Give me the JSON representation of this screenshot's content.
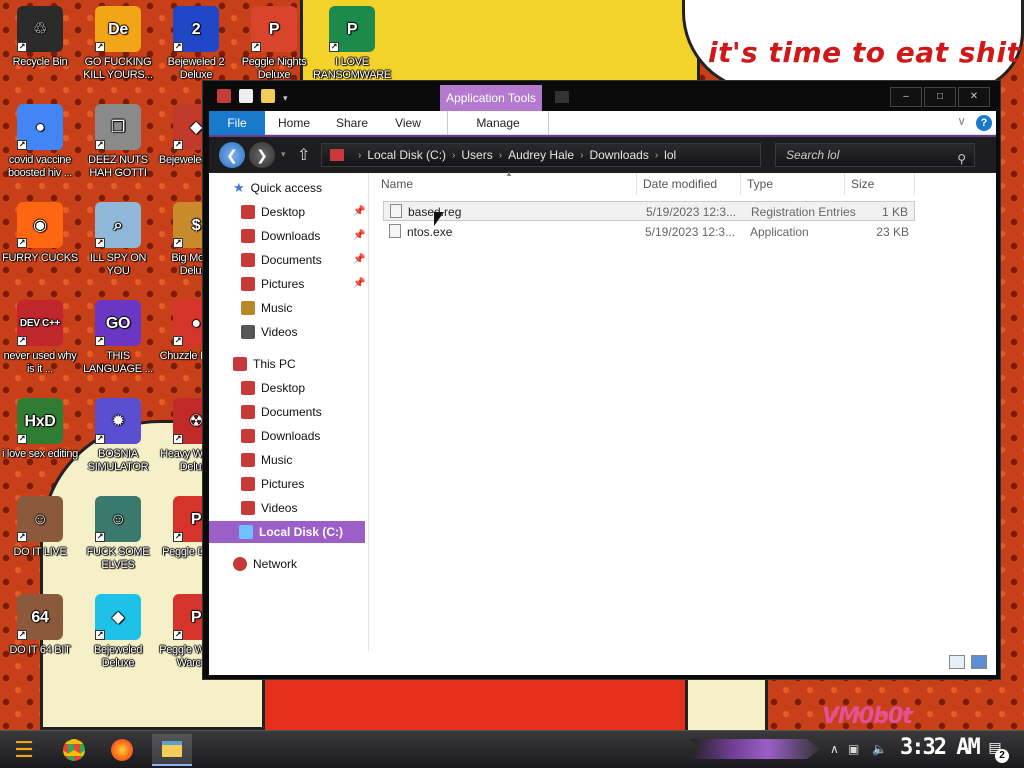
{
  "wallpaper": {
    "bubble_text": "it's time to eat shit",
    "signature": "VM0b0t"
  },
  "desktop_icons": [
    {
      "label": "Recycle Bin",
      "icon": "recycle-bin-icon",
      "color": "#2b2b2b",
      "glyph": "♲"
    },
    {
      "label": "GO FUCKING KILL YOURS...",
      "icon": "de-app-icon",
      "color": "#f2a516",
      "glyph": "De"
    },
    {
      "label": "Bejeweled 2 Deluxe",
      "icon": "bejeweled-2-icon",
      "color": "#2047c8",
      "glyph": "2"
    },
    {
      "label": "Peggle Nights Deluxe",
      "icon": "peggle-nights-icon",
      "color": "#d9452b",
      "glyph": "P"
    },
    {
      "label": "I LOVE RANSOMWARE",
      "icon": "project-icon",
      "color": "#1c8a4b",
      "glyph": "P"
    },
    {
      "label": "covid vaccine boosted hiv ...",
      "icon": "chrome-icon",
      "color": "#4285f4",
      "glyph": "●"
    },
    {
      "label": "DEEZ NUTS HAH GOTTI",
      "icon": "copy-icon",
      "color": "#8a8a8a",
      "glyph": "❐"
    },
    {
      "label": "Bejeweled Twist",
      "icon": "bejeweled-twist-icon",
      "color": "#c0392b",
      "glyph": "◆"
    },
    {
      "label": "FURRY CUCKS",
      "icon": "firefox-icon",
      "color": "#ff6611",
      "glyph": "◉"
    },
    {
      "label": "ILL SPY ON YOU",
      "icon": "spy-icon",
      "color": "#8fb7d8",
      "glyph": "⌕"
    },
    {
      "label": "Big Money Deluxe",
      "icon": "big-money-icon",
      "color": "#c98a2b",
      "glyph": "$"
    },
    {
      "label": "never used why is it ...",
      "icon": "devcpp-icon",
      "color": "#c0262c",
      "glyph": "DEV C++"
    },
    {
      "label": "THIS LANGUAGE ...",
      "icon": "goland-icon",
      "color": "#6a36c4",
      "glyph": "GO"
    },
    {
      "label": "Chuzzle Deluxe",
      "icon": "chuzzle-icon",
      "color": "#d6342a",
      "glyph": "●"
    },
    {
      "label": "i love sex editing",
      "icon": "hxd-icon",
      "color": "#2f7d32",
      "glyph": "HxD"
    },
    {
      "label": "BOSNIA SIMULATOR",
      "icon": "mine-icon",
      "color": "#5a4fd0",
      "glyph": "✹"
    },
    {
      "label": "Heavy Weapon Deluxe",
      "icon": "heavy-weapon-icon",
      "color": "#c22a2a",
      "glyph": "☢"
    },
    {
      "label": "DO IT LIVE",
      "icon": "portrait-icon",
      "color": "#8b5a3c",
      "glyph": "☺"
    },
    {
      "label": "FUCK SOME ELVES",
      "icon": "elf-icon",
      "color": "#3a7a6e",
      "glyph": "☺"
    },
    {
      "label": "Peggle Deluxe",
      "icon": "peggle-icon",
      "color": "#d6342a",
      "glyph": "P"
    },
    {
      "label": "DO IT 64 BIT",
      "icon": "portrait-64-icon",
      "color": "#8b5a3c",
      "glyph": "64"
    },
    {
      "label": "Bejeweled Deluxe",
      "icon": "bejeweled-icon",
      "color": "#1ec2e8",
      "glyph": "◆"
    },
    {
      "label": "Peggle World of Warcraft",
      "icon": "peggle-wow-icon",
      "color": "#d6342a",
      "glyph": "P"
    }
  ],
  "window": {
    "app_tools_label": "Application Tools",
    "ribbon_tabs": [
      "File",
      "Home",
      "Share",
      "View",
      "Manage"
    ],
    "help_glyph": "?",
    "address": {
      "segments": [
        "Local Disk (C:)",
        "Users",
        "Audrey Hale",
        "Downloads",
        "lol"
      ]
    },
    "search_placeholder": "Search lol",
    "nav": {
      "quick_access": "Quick access",
      "quick_items": [
        "Desktop",
        "Downloads",
        "Documents",
        "Pictures",
        "Music",
        "Videos"
      ],
      "this_pc": "This PC",
      "pc_items": [
        "Desktop",
        "Documents",
        "Downloads",
        "Music",
        "Pictures",
        "Videos",
        "Local Disk (C:)"
      ],
      "network": "Network"
    },
    "columns": [
      "Name",
      "Date modified",
      "Type",
      "Size"
    ],
    "files": [
      {
        "name": "based.reg",
        "date": "5/19/2023 12:3...",
        "type": "Registration Entries",
        "size": "1 KB",
        "selected": true
      },
      {
        "name": "ntos.exe",
        "date": "5/19/2023 12:3...",
        "type": "Application",
        "size": "23 KB",
        "selected": false
      }
    ]
  },
  "taskbar": {
    "clock": "3:32 AM",
    "notifications": "2"
  }
}
